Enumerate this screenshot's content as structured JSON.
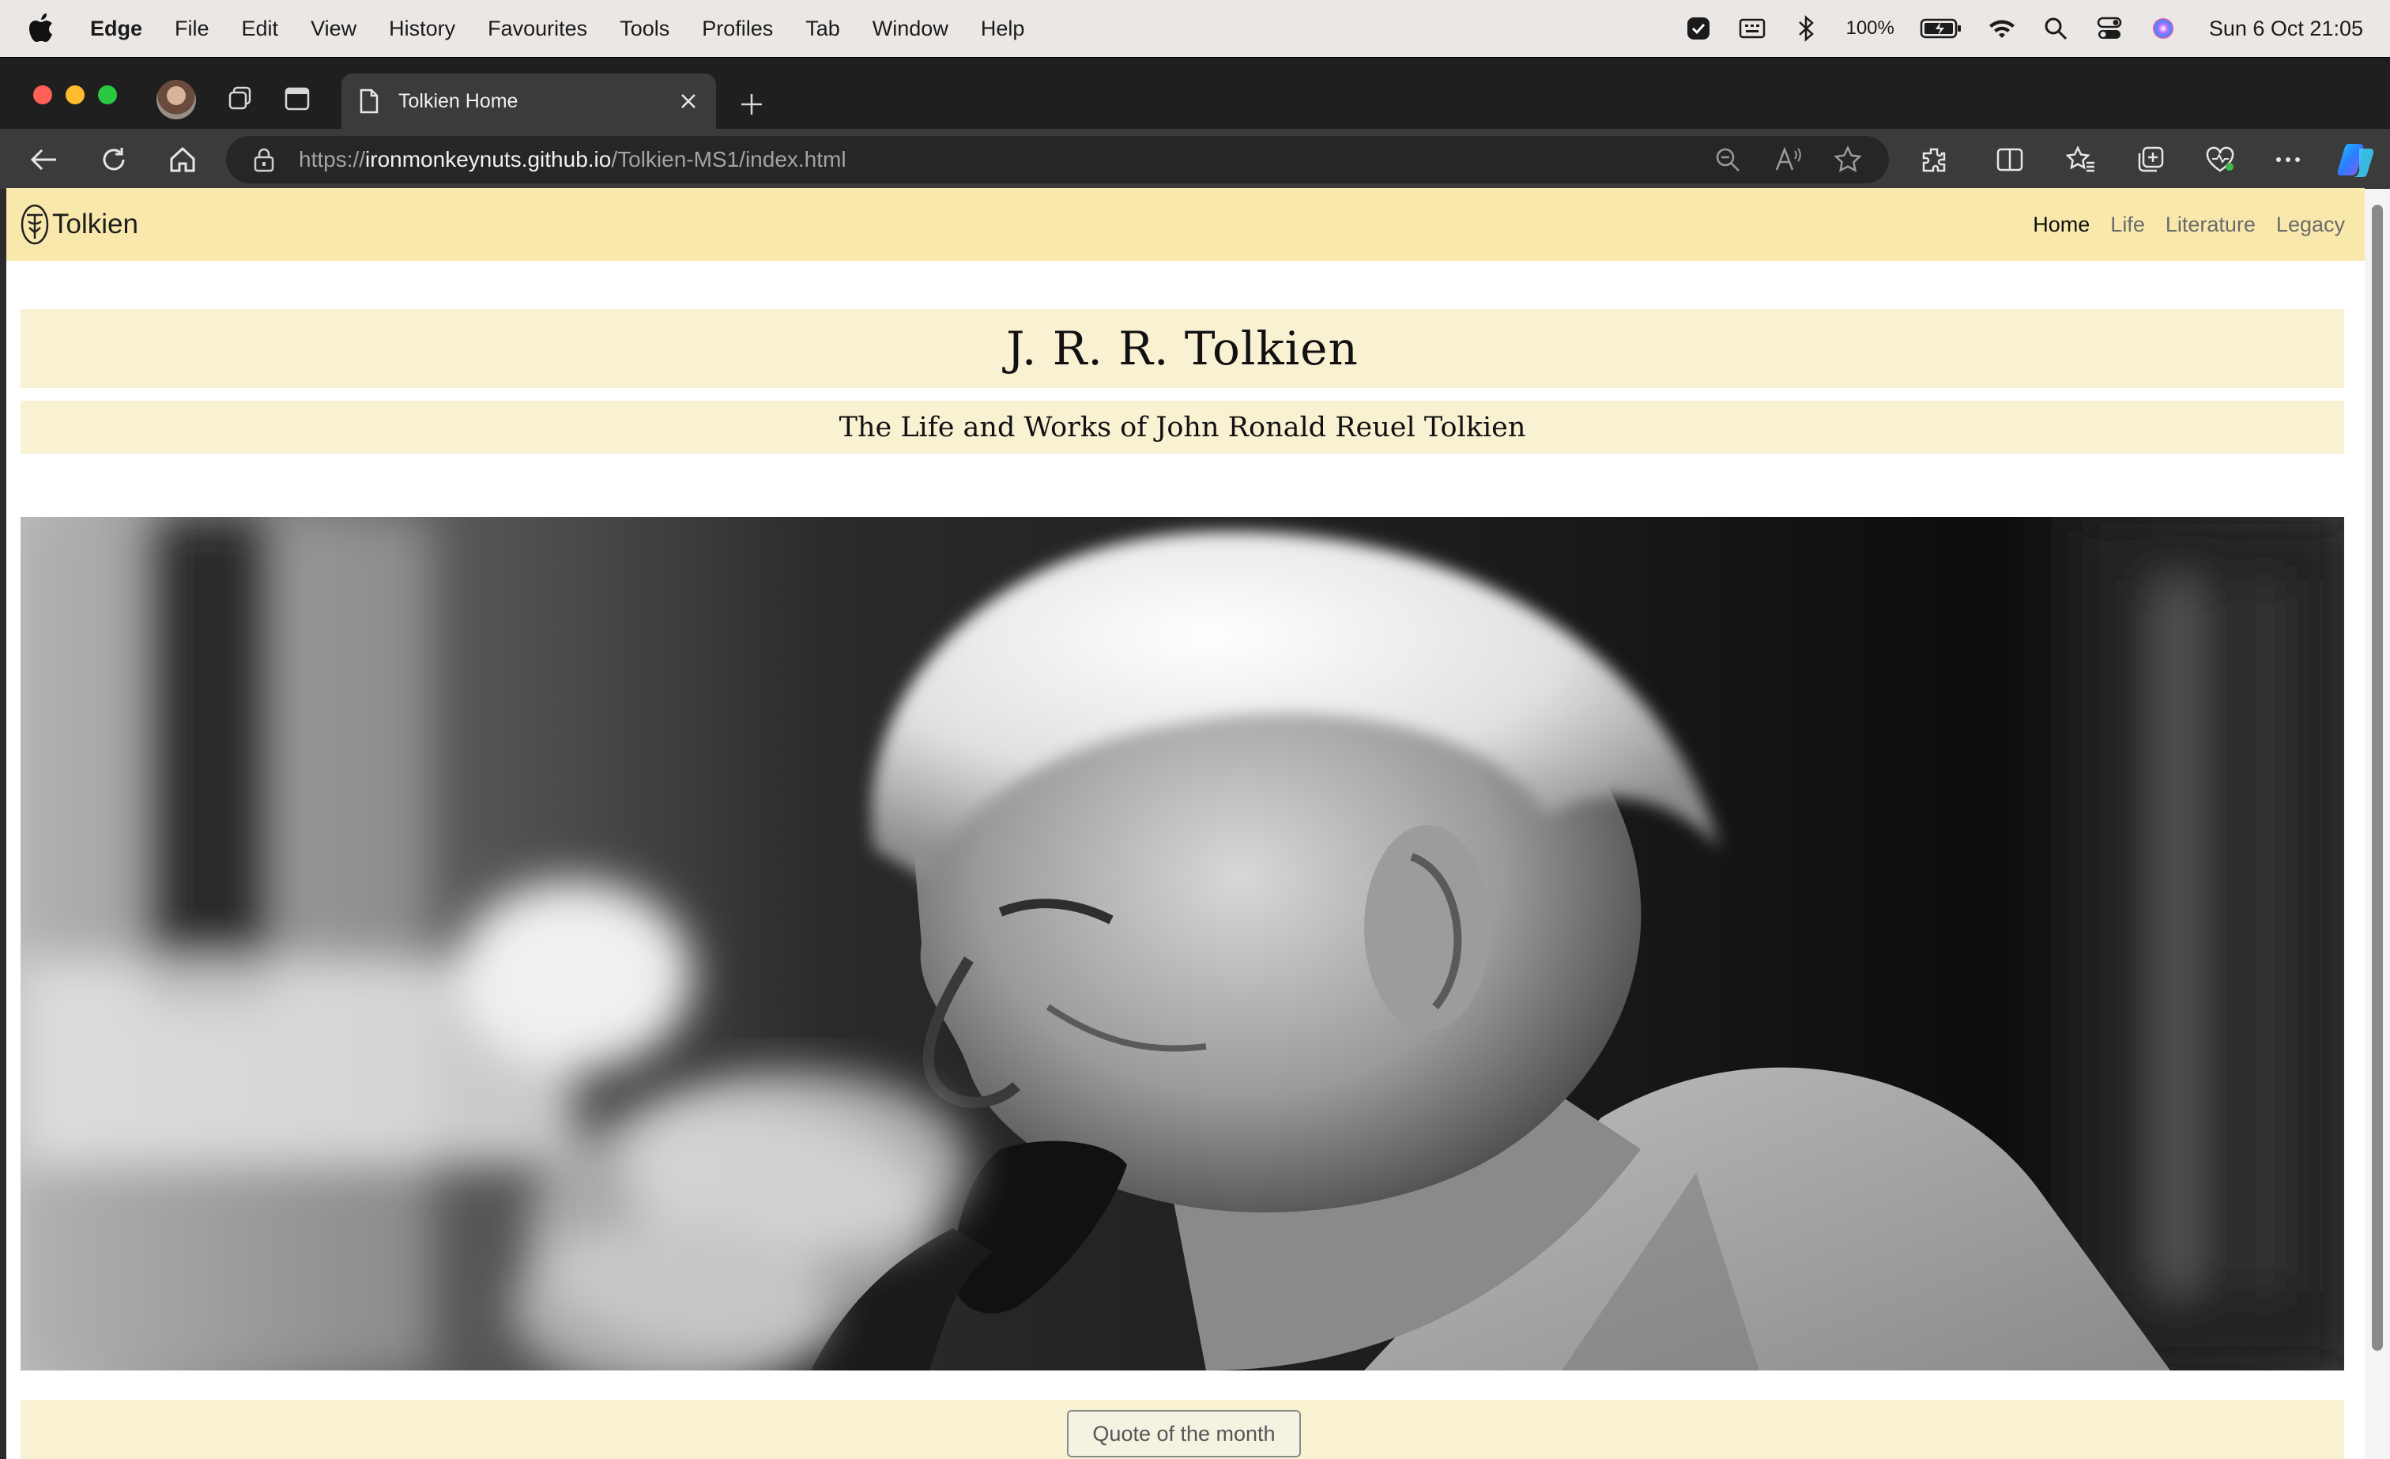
{
  "menubar": {
    "app_name": "Edge",
    "items": [
      "File",
      "Edit",
      "View",
      "History",
      "Favourites",
      "Tools",
      "Profiles",
      "Tab",
      "Window",
      "Help"
    ],
    "battery": "100%",
    "clock": "Sun 6 Oct  21:05"
  },
  "browser": {
    "tab_title": "Tolkien Home",
    "url_scheme": "https://",
    "url_host": "ironmonkeynuts.github.io",
    "url_path": "/Tolkien-MS1/index.html"
  },
  "site": {
    "brand": "Tolkien",
    "nav": [
      "Home",
      "Life",
      "Literature",
      "Legacy"
    ],
    "title": "J. R. R. Tolkien",
    "subtitle": "The Life and Works of John Ronald Reuel Tolkien",
    "quote_button": "Quote of the month"
  },
  "colors": {
    "nav_bg": "#f8e8ab",
    "band_bg": "#f8f1d2",
    "browser_chrome": "#3b3b3b"
  }
}
